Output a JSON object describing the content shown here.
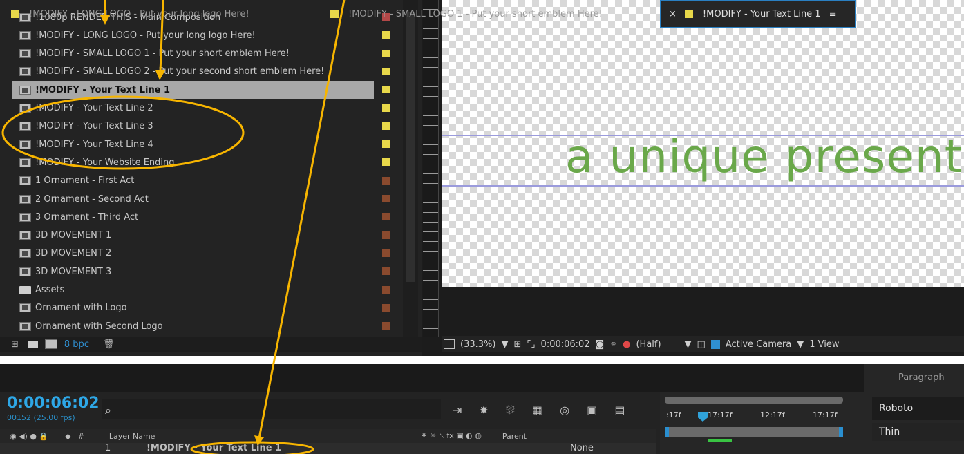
{
  "project": {
    "items": [
      {
        "label": "!1080p RENDER THIS - Main Composition",
        "color": "#b34848",
        "kind": "comp"
      },
      {
        "label": "!MODIFY - LONG LOGO - Put your long logo Here!",
        "color": "#e8d84a",
        "kind": "comp"
      },
      {
        "label": "!MODIFY - SMALL LOGO 1 - Put your short emblem Here!",
        "color": "#e8d84a",
        "kind": "comp"
      },
      {
        "label": "!MODIFY - SMALL LOGO 2 - Put your second short emblem Here!",
        "color": "#e8d84a",
        "kind": "comp"
      },
      {
        "label": "!MODIFY - Your Text Line 1",
        "color": "#e8d84a",
        "kind": "comp",
        "selected": true
      },
      {
        "label": "!MODIFY - Your Text Line 2",
        "color": "#e8d84a",
        "kind": "comp"
      },
      {
        "label": "!MODIFY - Your Text Line 3",
        "color": "#e8d84a",
        "kind": "comp"
      },
      {
        "label": "!MODIFY - Your Text Line 4",
        "color": "#e8d84a",
        "kind": "comp"
      },
      {
        "label": "!MODIFY - Your Website Ending",
        "color": "#e8d84a",
        "kind": "comp"
      },
      {
        "label": "1 Ornament - First Act",
        "color": "#8a4a2e",
        "kind": "comp"
      },
      {
        "label": "2 Ornament - Second Act",
        "color": "#8a4a2e",
        "kind": "comp"
      },
      {
        "label": "3 Ornament - Third Act",
        "color": "#8a4a2e",
        "kind": "comp"
      },
      {
        "label": "3D MOVEMENT 1",
        "color": "#8a4a2e",
        "kind": "comp"
      },
      {
        "label": "3D MOVEMENT 2",
        "color": "#8a4a2e",
        "kind": "comp"
      },
      {
        "label": "3D MOVEMENT 3",
        "color": "#8a4a2e",
        "kind": "comp"
      },
      {
        "label": "Assets",
        "color": "#8a4a2e",
        "kind": "folder"
      },
      {
        "label": "Ornament with Logo",
        "color": "#8a4a2e",
        "kind": "comp"
      },
      {
        "label": "Ornament with Second Logo",
        "color": "#8a4a2e",
        "kind": "comp"
      }
    ],
    "bpc": "8 bpc"
  },
  "viewer": {
    "comp_text": "a unique present",
    "zoom": "(33.3%)",
    "timecode": "0:00:06:02",
    "resolution": "(Half)",
    "camera": "Active Camera",
    "views": "1 View"
  },
  "tabs": [
    {
      "label": "!MODIFY - LONG LOGO - Put your long logo Here!"
    },
    {
      "label": "!MODIFY - SMALL LOGO 1 - Put your short emblem Here!"
    },
    {
      "label": "!MODIFY - Your Text Line 1",
      "active": true
    }
  ],
  "timeline": {
    "timecode": "0:00:06:02",
    "frames": "00152 (25.00 fps)",
    "search_placeholder": "",
    "columns": {
      "layer_name": "Layer Name",
      "parent": "Parent",
      "num": "#"
    },
    "layer": {
      "index": "1",
      "name": "!MODIFY - Your Text Line 1",
      "parent": "None"
    },
    "ticks": [
      ":17f",
      "17:17f",
      "12:17f",
      "17:17f"
    ]
  },
  "paragraph_panel": {
    "tab": "Paragraph",
    "font": "Roboto",
    "style": "Thin"
  },
  "colors": {
    "accent": "#2a8fd0",
    "annotation": "#f7b500",
    "comp_text": "#6aa84a"
  }
}
